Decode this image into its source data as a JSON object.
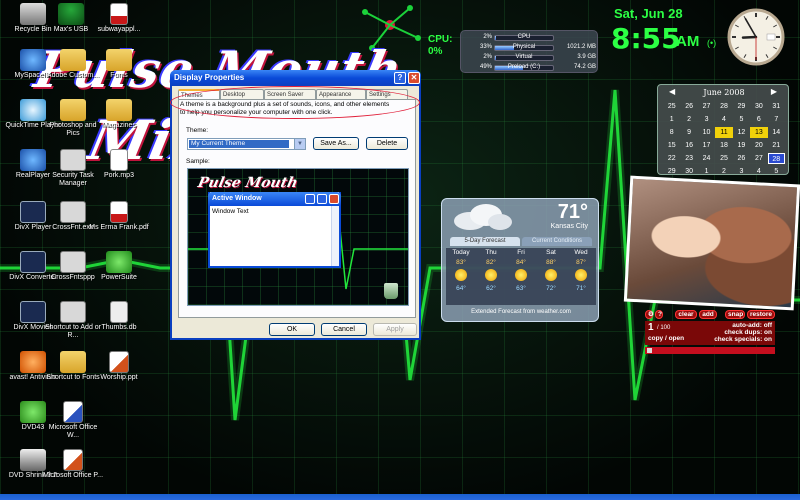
{
  "wallpaper": {
    "title": "Pulse Mouth",
    "title_line2": "Mix"
  },
  "desktop_icons": [
    {
      "label": "Recycle Bin",
      "icon": "recycle-bin-icon"
    },
    {
      "label": "Max's USB",
      "icon": "usb-drive-icon"
    },
    {
      "label": "subwayappl...",
      "icon": "pdf-file-icon"
    },
    {
      "label": "MySpaceIM",
      "icon": "myspace-im-icon"
    },
    {
      "label": "Adobe Custom...",
      "icon": "folder-icon"
    },
    {
      "label": "Fonts",
      "icon": "folder-icon"
    },
    {
      "label": "QuickTime Player",
      "icon": "quicktime-icon"
    },
    {
      "label": "Photoshop and Pics",
      "icon": "folder-icon"
    },
    {
      "label": "Magazines",
      "icon": "folder-icon"
    },
    {
      "label": "RealPlayer",
      "icon": "realplayer-icon"
    },
    {
      "label": "Security Task Manager",
      "icon": "security-task-manager-icon"
    },
    {
      "label": "Pork.mp3",
      "icon": "mp3-file-icon"
    },
    {
      "label": "DivX Player",
      "icon": "divx-player-icon"
    },
    {
      "label": "CrossFnt.exe",
      "icon": "exe-file-icon"
    },
    {
      "label": "Ms Erma Frank.pdf",
      "icon": "pdf-file-icon"
    },
    {
      "label": "DivX Converter",
      "icon": "divx-converter-icon"
    },
    {
      "label": "CrossFntsppp",
      "icon": "exe-file-icon"
    },
    {
      "label": "PowerSuite",
      "icon": "powersuite-icon"
    },
    {
      "label": "DivX Movies",
      "icon": "divx-movies-icon"
    },
    {
      "label": "Shortcut to Add or R...",
      "icon": "shortcut-icon"
    },
    {
      "label": "Thumbs.db",
      "icon": "db-file-icon"
    },
    {
      "label": "avast! Antivirus",
      "icon": "avast-icon"
    },
    {
      "label": "Shortcut to Fonts",
      "icon": "shortcut-folder-icon"
    },
    {
      "label": "Worship.ppt",
      "icon": "powerpoint-file-icon"
    },
    {
      "label": "DVD43",
      "icon": "dvd43-icon"
    },
    {
      "label": "Microsoft Office W...",
      "icon": "word-icon"
    },
    {
      "label": "DVD Shrink 3.2",
      "icon": "dvd-shrink-icon"
    },
    {
      "label": "Microsoft Office P...",
      "icon": "powerpoint-icon"
    }
  ],
  "dialog": {
    "title": "Display Properties",
    "help_label": "?",
    "close_label": "✕",
    "tabs": [
      "Themes",
      "Desktop",
      "Screen Saver",
      "Appearance",
      "Settings"
    ],
    "description": "A theme is a background plus a set of sounds, icons, and other elements to help you personalize your computer with one click.",
    "theme_label": "Theme:",
    "theme_value": "My Current Theme",
    "save_as_label": "Save As...",
    "delete_label": "Delete",
    "sample_label": "Sample:",
    "sample_wallpaper": "Pulse Mouth",
    "active_window_title": "Active Window",
    "window_text": "Window Text",
    "ok_label": "OK",
    "cancel_label": "Cancel",
    "apply_label": "Apply"
  },
  "cpu": {
    "label": "CPU:",
    "percent": "0%"
  },
  "meters": [
    {
      "percent": "2%",
      "name": "CPU",
      "amount": "",
      "fill": 0.02
    },
    {
      "percent": "33%",
      "name": "Physical",
      "amount": "1021.2 MB",
      "fill": 0.33
    },
    {
      "percent": "2%",
      "name": "Virtual",
      "amount": "3.9 GB",
      "fill": 0.02
    },
    {
      "percent": "49%",
      "name": "Preload (C:)",
      "amount": "74.2 GB",
      "fill": 0.49
    }
  ],
  "clock": {
    "date": "Sat, Jun 28",
    "time": "8:55",
    "ampm": "AM",
    "radio_icon": "(•)",
    "analog_hour": 8,
    "analog_minute": 55,
    "analog_second": 30
  },
  "calendar": {
    "month": "June 2008",
    "prev": "◀",
    "next": "▶",
    "days": [
      "25",
      "26",
      "27",
      "28",
      "29",
      "30",
      "31",
      "1",
      "2",
      "3",
      "4",
      "5",
      "6",
      "7",
      "8",
      "9",
      "10",
      "11",
      "12",
      "13",
      "14",
      "15",
      "16",
      "17",
      "18",
      "19",
      "20",
      "21",
      "22",
      "23",
      "24",
      "25",
      "26",
      "27",
      "28",
      "29",
      "30",
      "1",
      "2",
      "3",
      "4",
      "5"
    ],
    "marked": [
      "11",
      "13"
    ],
    "today": "28"
  },
  "weather": {
    "temp": "71°",
    "city": "Kansas City",
    "tab_forecast": "5-Day Forecast",
    "tab_current": "Current Conditions",
    "days": [
      {
        "name": "Today",
        "hi": "83°",
        "lo": "64°"
      },
      {
        "name": "Thu",
        "hi": "82°",
        "lo": "62°"
      },
      {
        "name": "Fri",
        "hi": "84°",
        "lo": "63°"
      },
      {
        "name": "Sat",
        "hi": "88°",
        "lo": "72°"
      },
      {
        "name": "Wed",
        "hi": "87°",
        "lo": "71°"
      }
    ],
    "footer": "Extended Forecast from weather.com"
  },
  "counter": {
    "buttons": [
      "clear",
      "add",
      "snap",
      "restore"
    ],
    "count": "1",
    "total": "/ 100",
    "copy_open": "copy / open",
    "auto_add": "auto-add: off",
    "check_dups": "check dups: on",
    "check_specials": "check specials: on"
  },
  "colors": {
    "accent_green": "#2cff44",
    "xp_blue": "#0a4ad8",
    "highlight_red": "#e0203a"
  }
}
